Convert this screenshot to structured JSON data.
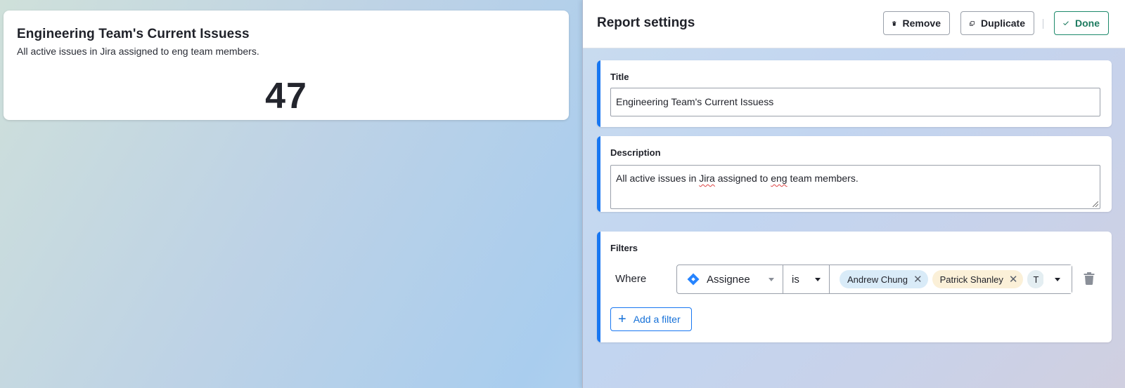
{
  "report_card": {
    "title": "Engineering Team's Current Issuess",
    "description": "All active issues in Jira assigned to eng team members.",
    "value": "47"
  },
  "settings": {
    "header_title": "Report settings",
    "remove_label": "Remove",
    "duplicate_label": "Duplicate",
    "done_label": "Done",
    "title_section": {
      "label": "Title",
      "value": "Engineering Team's Current Issuess"
    },
    "description_section": {
      "label": "Description",
      "value_parts": [
        "All active issues in ",
        "Jira",
        " assigned to ",
        "eng",
        " team members."
      ]
    },
    "filters_section": {
      "label": "Filters",
      "where_label": "Where",
      "field": {
        "icon": "jira-icon",
        "label": "Assignee"
      },
      "operator": "is",
      "values": [
        {
          "label": "Andrew Chung",
          "color": "#d9ebf8"
        },
        {
          "label": "Patrick Shanley",
          "color": "#fbf0d8"
        },
        {
          "label": "T",
          "color": "#e4eef2"
        }
      ],
      "add_filter_label": "Add a filter"
    }
  },
  "colors": {
    "accent": "#1877f2",
    "done_green": "#1d7a5f",
    "jira_blue": "#2684ff"
  }
}
